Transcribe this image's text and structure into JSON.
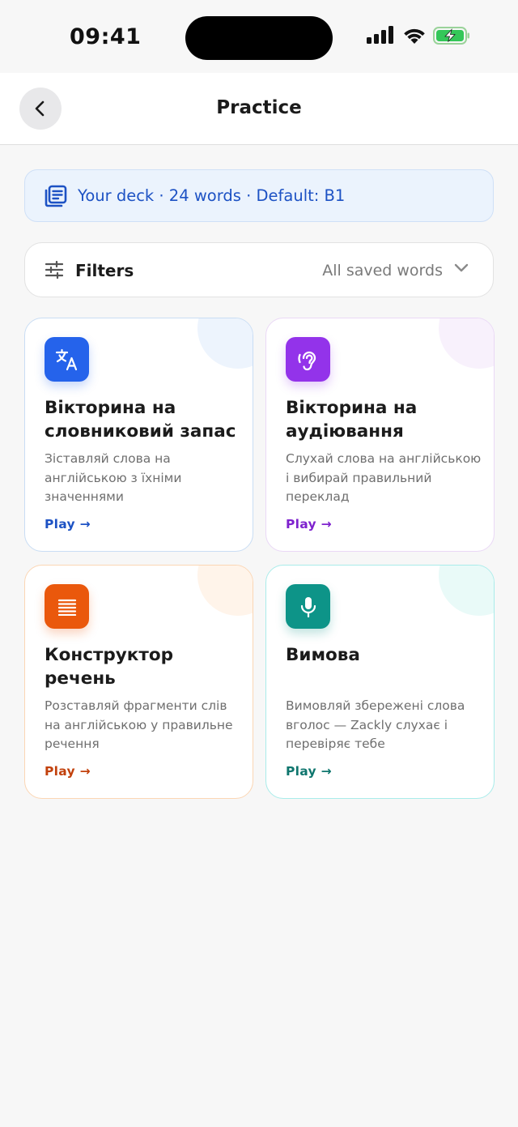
{
  "status_bar": {
    "time": "09:41",
    "icons": [
      "signal-icon",
      "wifi-icon",
      "battery-charging-icon"
    ]
  },
  "header": {
    "title": "Practice",
    "back_icon": "chevron-left-icon"
  },
  "deck_banner": {
    "icon": "deck-list-icon",
    "text": "Your deck · 24 words · Default: B1"
  },
  "filters": {
    "icon": "sliders-icon",
    "label": "Filters",
    "value": "All saved words",
    "chevron": "chevron-down-icon"
  },
  "cards": {
    "vocab": {
      "icon": "translate-icon",
      "title": "Вікторина на словниковий запас",
      "description": "Зіставляй слова на англійською з їхніми значеннями",
      "play": "Play →",
      "accent": "#2563eb"
    },
    "listening": {
      "icon": "ear-icon",
      "title": "Вікторина на аудіювання",
      "description": "Слухай слова на англійською і вибирай правильний переклад",
      "play": "Play →",
      "accent": "#9333ea"
    },
    "sentence": {
      "icon": "lines-icon",
      "title": "Конструктор речень",
      "description": "Розставляй фрагменти слів на англійською у правильне речення",
      "play": "Play →",
      "accent": "#ea580c"
    },
    "pronunciation": {
      "icon": "microphone-icon",
      "title": "Вимова",
      "description": "Вимовляй збережені слова вголос — Zackly слухає і перевіряє тебе",
      "play": "Play →",
      "accent": "#0d9488"
    }
  }
}
